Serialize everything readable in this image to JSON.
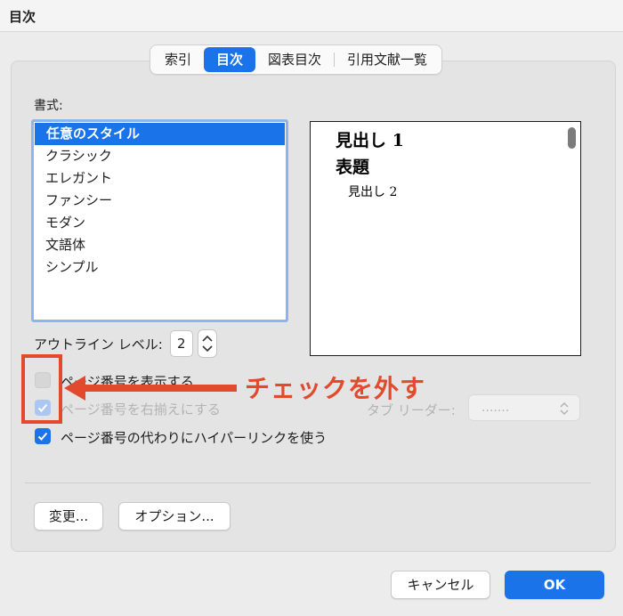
{
  "window": {
    "title": "目次"
  },
  "tabs": [
    {
      "label": "索引",
      "active": false
    },
    {
      "label": "目次",
      "active": true
    },
    {
      "label": "図表目次",
      "active": false
    },
    {
      "label": "引用文献一覧",
      "active": false
    }
  ],
  "format": {
    "label": "書式:",
    "items": [
      "任意のスタイル",
      "クラシック",
      "エレガント",
      "ファンシー",
      "モダン",
      "文語体",
      "シンプル"
    ],
    "selected": "任意のスタイル"
  },
  "preview": {
    "heading1": "見出し 1",
    "title": "表題",
    "heading2": "見出し 2"
  },
  "outline": {
    "label": "アウトライン レベル:",
    "value": "2"
  },
  "options": {
    "show_page_numbers": {
      "label": "ページ番号を表示する",
      "checked": false
    },
    "right_align": {
      "label": "ページ番号を右揃えにする",
      "checked": true,
      "disabled": true
    },
    "hyperlinks": {
      "label": "ページ番号の代わりにハイパーリンクを使う",
      "checked": true
    }
  },
  "tab_leader": {
    "label": "タブ リーダー:",
    "value": "......."
  },
  "annotation": {
    "text": "チェックを外す",
    "color": "#e24a2e"
  },
  "buttons": {
    "modify": "変更...",
    "options": "オプション...",
    "cancel": "キャンセル",
    "ok": "OK"
  },
  "colors": {
    "accent": "#1a73e8"
  }
}
